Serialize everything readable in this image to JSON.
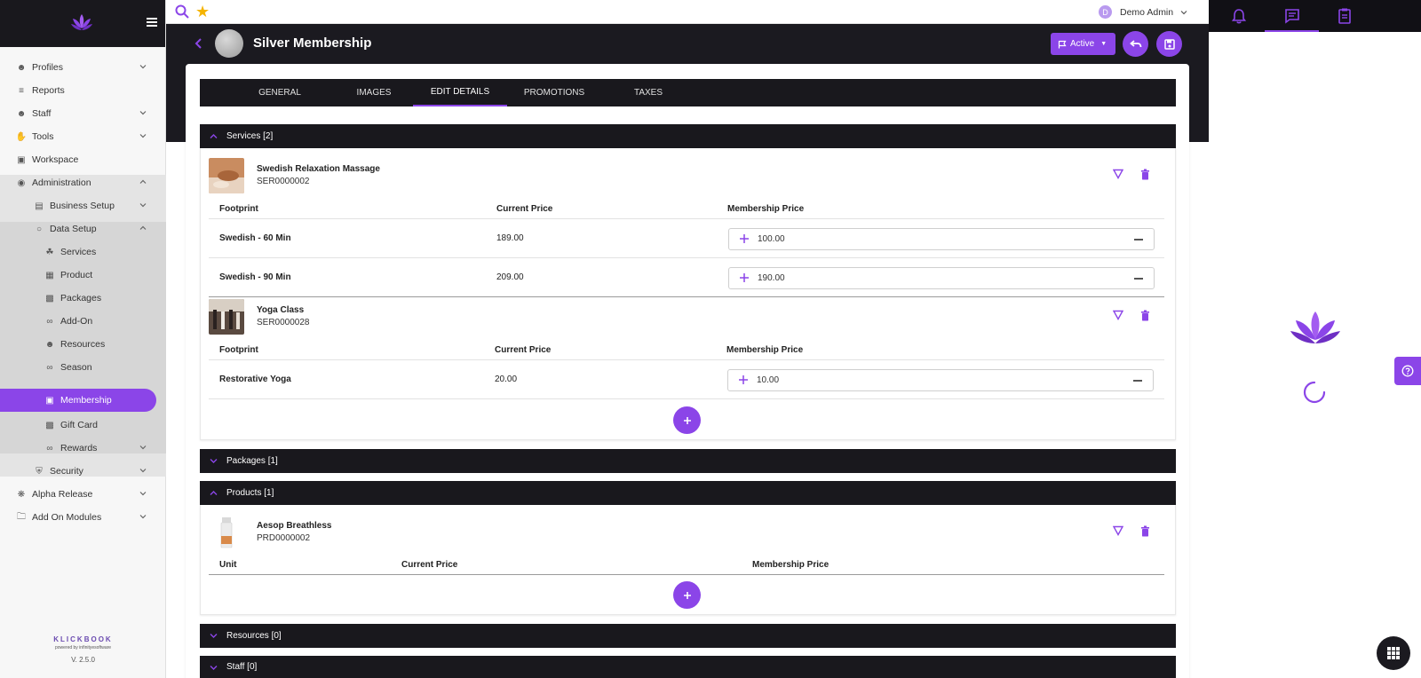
{
  "sidebar": {
    "items": [
      {
        "label": "Profiles"
      },
      {
        "label": "Reports"
      },
      {
        "label": "Staff"
      },
      {
        "label": "Tools"
      },
      {
        "label": "Workspace"
      },
      {
        "label": "Administration"
      },
      {
        "label": "Business Setup"
      },
      {
        "label": "Data Setup"
      },
      {
        "label": "Services"
      },
      {
        "label": "Product"
      },
      {
        "label": "Packages"
      },
      {
        "label": "Add-On"
      },
      {
        "label": "Resources"
      },
      {
        "label": "Season"
      },
      {
        "label": "Membership"
      },
      {
        "label": "Gift Card"
      },
      {
        "label": "Rewards"
      },
      {
        "label": "Security"
      },
      {
        "label": "Alpha Release"
      },
      {
        "label": "Add On Modules"
      }
    ],
    "footer": {
      "brand": "KLICKBOOK",
      "powered": "powered by infinityesoftware",
      "version": "V. 2.5.0"
    }
  },
  "topbar": {
    "user_initial": "D",
    "user_name": "Demo Admin"
  },
  "page": {
    "title": "Silver Membership",
    "status_label": "Active"
  },
  "tabs": [
    {
      "label": "GENERAL"
    },
    {
      "label": "IMAGES"
    },
    {
      "label": "EDIT DETAILS"
    },
    {
      "label": "PROMOTIONS"
    },
    {
      "label": "TAXES"
    }
  ],
  "sections": {
    "services": {
      "label": "Services [2]"
    },
    "packages": {
      "label": "Packages [1]"
    },
    "products": {
      "label": "Products [1]"
    },
    "resources": {
      "label": "Resources [0]"
    },
    "staff": {
      "label": "Staff [0]"
    }
  },
  "services": [
    {
      "name": "Swedish Relaxation Massage",
      "code": "SER0000002",
      "headers": [
        "Footprint",
        "Current Price",
        "Membership Price"
      ],
      "rows": [
        {
          "footprint": "Swedish - 60 Min",
          "current_price": "189.00",
          "membership_price": "100.00"
        },
        {
          "footprint": "Swedish - 90 Min",
          "current_price": "209.00",
          "membership_price": "190.00"
        }
      ]
    },
    {
      "name": "Yoga Class",
      "code": "SER0000028",
      "headers": [
        "Footprint",
        "Current Price",
        "Membership Price"
      ],
      "rows": [
        {
          "footprint": "Restorative Yoga",
          "current_price": "20.00",
          "membership_price": "10.00"
        }
      ]
    }
  ],
  "products": [
    {
      "name": "Aesop Breathless",
      "code": "PRD0000002",
      "headers": [
        "Unit",
        "Current Price",
        "Membership Price"
      ]
    }
  ],
  "colors": {
    "accent": "#8b45e8",
    "dark": "#19181d",
    "star": "#f5b400"
  }
}
